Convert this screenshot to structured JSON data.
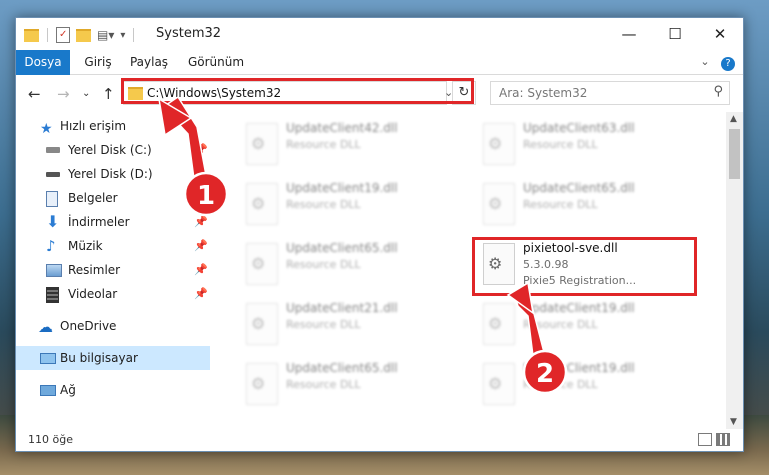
{
  "window": {
    "title": "System32"
  },
  "ribbon": {
    "tabs": [
      "Dosya",
      "Giriş",
      "Paylaş",
      "Görünüm"
    ]
  },
  "address": {
    "path": "C:\\Windows\\System32"
  },
  "search": {
    "placeholder": "Ara: System32"
  },
  "nav": {
    "items": [
      {
        "label": "Hızlı erişim",
        "icon": "star-icon"
      },
      {
        "label": "Yerel Disk (C:)",
        "icon": "drive-icon"
      },
      {
        "label": "Yerel Disk (D:)",
        "icon": "drive-icon"
      },
      {
        "label": "Belgeler",
        "icon": "documents-icon"
      },
      {
        "label": "İndirmeler",
        "icon": "download-icon"
      },
      {
        "label": "Müzik",
        "icon": "music-icon"
      },
      {
        "label": "Resimler",
        "icon": "pictures-icon"
      },
      {
        "label": "Videolar",
        "icon": "video-icon"
      },
      {
        "label": "OneDrive",
        "icon": "cloud-icon"
      },
      {
        "label": "Bu bilgisayar",
        "icon": "computer-icon"
      },
      {
        "label": "Ağ",
        "icon": "network-icon"
      }
    ]
  },
  "files": [
    {
      "name": "UpdateClient42.dll",
      "type": "Resource DLL"
    },
    {
      "name": "UpdateClient63.dll",
      "type": "Resource DLL"
    },
    {
      "name": "UpdateClient19.dll",
      "type": "Resource DLL"
    },
    {
      "name": "UpdateClient65.dll",
      "type": "Resource DLL"
    },
    {
      "name": "UpdateClient65.dll",
      "type": "Resource DLL"
    },
    {
      "name": "pixietool-sve.dll",
      "version": "5.3.0.98",
      "description": "Pixie5 Registration..."
    },
    {
      "name": "UpdateClient21.dll",
      "type": "Resource DLL"
    },
    {
      "name": "UpdateClient19.dll",
      "type": "Resource DLL"
    },
    {
      "name": "UpdateClient65.dll",
      "type": "Resource DLL"
    },
    {
      "name": "UpdateClient19.dll",
      "type": "Resource DLL"
    }
  ],
  "status": {
    "count": "110 öğe"
  },
  "callouts": {
    "step1": "1",
    "step2": "2"
  },
  "colors": {
    "accent": "#1979ca",
    "highlight": "#e02628",
    "selected": "#cce8ff"
  }
}
